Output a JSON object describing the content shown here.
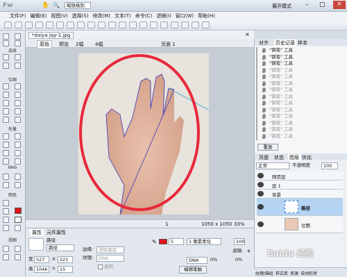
{
  "app": {
    "logo": "Fw",
    "workspace": "缩放级别",
    "mode": "展开模式"
  },
  "menu": [
    "文件(F)",
    "编辑(E)",
    "视图(V)",
    "选择(S)",
    "修改(M)",
    "文本(T)",
    "命令(C)",
    "滤镜(I)",
    "窗口(W)",
    "帮助(H)"
  ],
  "tools": {
    "sections": [
      "选择",
      "位图",
      "矢量",
      "Web",
      "颜色",
      "视图"
    ]
  },
  "doc": {
    "tab": "*daiya jqy-1.jpg",
    "views": [
      "原始",
      "预览",
      "2幅",
      "4幅"
    ],
    "page": "页面 1",
    "page_num": "1",
    "size": "1050 x 1050",
    "zoom": "33%"
  },
  "history": {
    "tabs": [
      "对齐",
      "历史记录",
      "样本"
    ],
    "steps": [
      {
        "label": "\"钢笔\" 工具",
        "dim": false
      },
      {
        "label": "\"钢笔\" 工具",
        "dim": false
      },
      {
        "label": "\"钢笔\" 工具",
        "dim": false
      },
      {
        "label": "\"钢笔\" 工具",
        "dim": true
      },
      {
        "label": "\"钢笔\" 工具",
        "dim": true
      },
      {
        "label": "\"钢笔\" 工具",
        "dim": true
      },
      {
        "label": "\"钢笔\" 工具",
        "dim": true
      },
      {
        "label": "\"钢笔\" 工具",
        "dim": true
      },
      {
        "label": "\"钢笔\" 工具",
        "dim": true
      },
      {
        "label": "\"钢笔\" 工具",
        "dim": true
      },
      {
        "label": "\"钢笔\" 工具",
        "dim": true
      },
      {
        "label": "\"钢笔\" 工具",
        "dim": true
      },
      {
        "label": "\"钢笔\" 工具",
        "dim": true
      },
      {
        "label": "\"钢笔\" 工具",
        "dim": true
      }
    ],
    "replay": "重放"
  },
  "layers": {
    "tabs": [
      "页面",
      "状态",
      "图层",
      "优化"
    ],
    "blend": "正常",
    "opacity_label": "不透明度",
    "opacity": "100",
    "items": [
      {
        "name": "网页层"
      },
      {
        "name": "层 1"
      },
      {
        "name": "背景"
      },
      {
        "name": "路径"
      },
      {
        "name": "位图"
      }
    ]
  },
  "props": {
    "tabs": [
      "属性",
      "元件属性"
    ],
    "name1": "路径",
    "name2": "路径",
    "w_label": "宽",
    "w": "527",
    "x_label": "X:",
    "x": "221",
    "h_label": "高",
    "h": "1046",
    "y_label": "Y:",
    "y": "15",
    "edge_label": "边缘:",
    "edge": "消除锯齿",
    "texture_label": "纹理:",
    "texture": "DNA",
    "transparent": "透明",
    "stroke_size": "5",
    "stroke_edge": "1 像素柔化",
    "stroke_texture": "DNA",
    "stroke_pct": "0%",
    "edit_stroke": "编辑笔触",
    "opacity": "100",
    "filter_label": "滤镜:",
    "fill_pct": "0%"
  },
  "bottom_tabs": [
    "纹理/描绘",
    "样式库",
    "资源",
    "自动形状"
  ],
  "watermark": "Baidu 经验"
}
